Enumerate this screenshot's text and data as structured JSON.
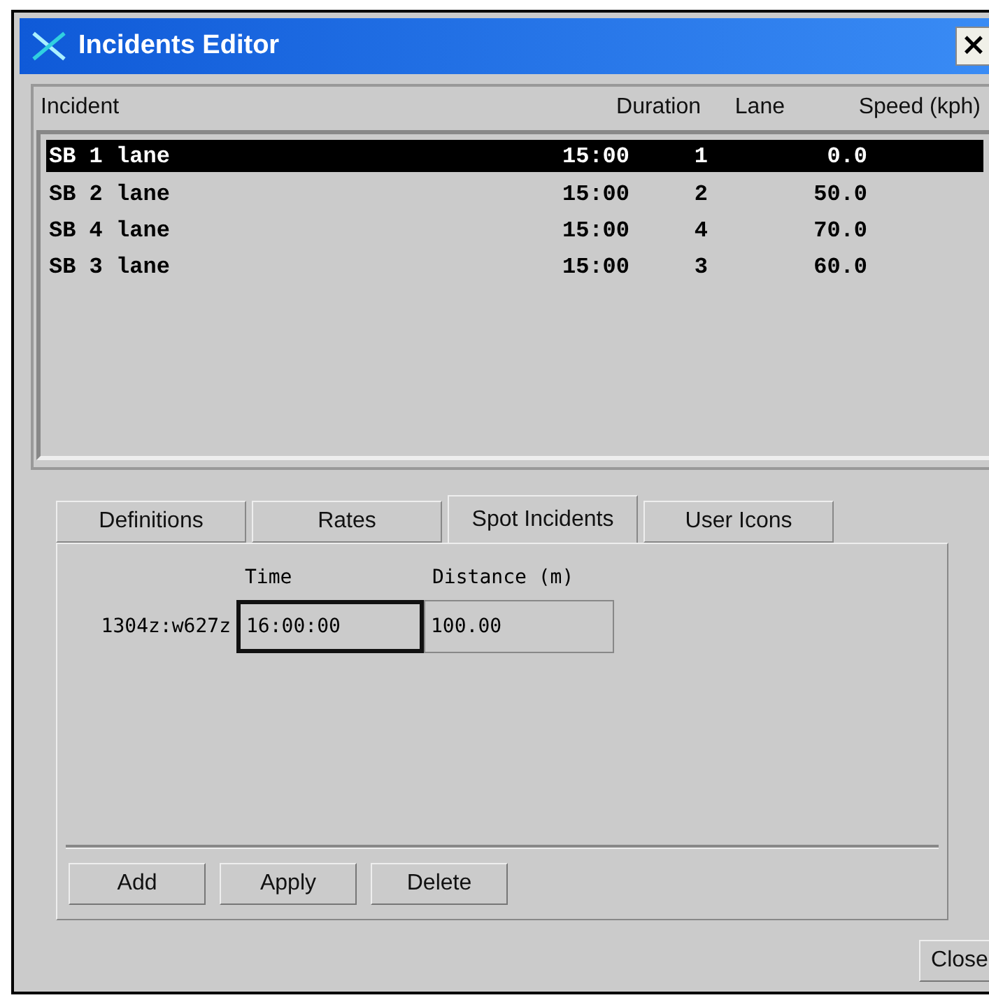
{
  "window": {
    "title": "Incidents Editor",
    "close": "×"
  },
  "incidents": {
    "columns": [
      "Incident",
      "Duration",
      "Lane",
      "Speed (kph)"
    ],
    "rows": [
      {
        "cells": [
          "SB 1 lane",
          "15:00",
          "1",
          "0.0"
        ],
        "selected": true
      },
      {
        "cells": [
          "SB 2 lane",
          "15:00",
          "2",
          "50.0"
        ],
        "selected": false
      },
      {
        "cells": [
          "SB 4 lane",
          "15:00",
          "4",
          "70.0"
        ],
        "selected": false
      },
      {
        "cells": [
          "SB 3 lane",
          "15:00",
          "3",
          "60.0"
        ],
        "selected": false
      }
    ]
  },
  "tabs": [
    {
      "label": "Definitions",
      "selected": false
    },
    {
      "label": "Rates",
      "selected": false
    },
    {
      "label": "Spot Incidents",
      "selected": true
    },
    {
      "label": "User Icons",
      "selected": false
    }
  ],
  "spot": {
    "headers": [
      "Time",
      "Distance (m)"
    ],
    "row_label": "1304z:w627z",
    "fields": [
      {
        "value": "16:00:00",
        "focused": true
      },
      {
        "value": "100.00",
        "focused": false
      }
    ]
  },
  "buttons": [
    "Add",
    "Apply",
    "Delete"
  ],
  "close_button": "Close"
}
